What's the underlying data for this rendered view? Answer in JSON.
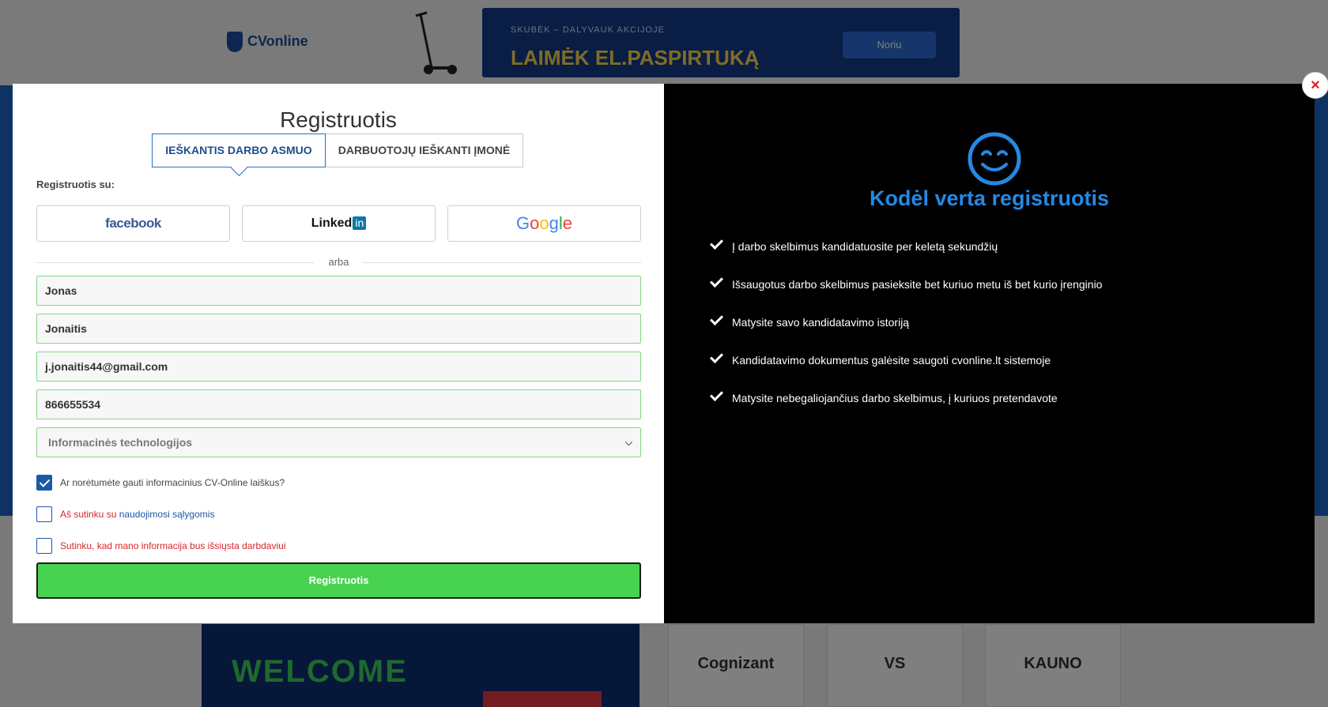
{
  "background": {
    "banner_small": "SKUBĖK – DALYVAUK AKCIJOJE",
    "banner_big": "LAIMĖK EL.PASPIRTUKĄ",
    "banner_button": "Noriu",
    "welcome_text": "WELCOME",
    "tile1": "Cognizant",
    "tile2": "VS",
    "tile3": "KAUNO"
  },
  "modal": {
    "close_label": "×",
    "title": "Registruotis",
    "tabs": [
      {
        "label": "IEŠKANTIS DARBO ASMUO",
        "active": true
      },
      {
        "label": "DARBUOTOJŲ IEŠKANTI ĮMONĖ",
        "active": false
      }
    ],
    "register_with": "Registruotis su:",
    "social": {
      "facebook": "facebook",
      "linkedin_text": "Linked",
      "linkedin_in": "in",
      "google": "Google"
    },
    "or_text": "arba",
    "fields": {
      "first_name": "Jonas",
      "last_name": "Jonaitis",
      "email": "j.jonaitis44@gmail.com",
      "phone": "866655534",
      "field_select": "Informacinės technologijos"
    },
    "checkboxes": {
      "newsletter": {
        "label": "Ar norėtumėte gauti informacinius CV-Online laiškus?",
        "checked": true
      },
      "terms": {
        "prefix": "Aš sutinku su ",
        "link": "naudojimosi sąlygomis",
        "checked": false
      },
      "share": {
        "label": "Sutinku, kad mano informacija bus išsiųsta darbdaviui",
        "checked": false
      }
    },
    "submit_label": "Registruotis"
  },
  "why": {
    "title": "Kodėl verta registruotis",
    "benefits": [
      "Į darbo skelbimus kandidatuosite per keletą sekundžių",
      "Išsaugotus darbo skelbimus pasieksite bet kuriuo metu iš bet kurio įrenginio",
      "Matysite savo kandidatavimo istoriją",
      "Kandidatavimo dokumentus galėsite saugoti cvonline.lt sistemoje",
      "Matysite nebegaliojančius darbo skelbimus, į kuriuos pretendavote"
    ]
  },
  "colors": {
    "accent_blue": "#2489e4",
    "tab_blue": "#1c59a7",
    "submit_green": "#47d34f",
    "field_border": "#88d688",
    "error_red": "#d9262c"
  }
}
